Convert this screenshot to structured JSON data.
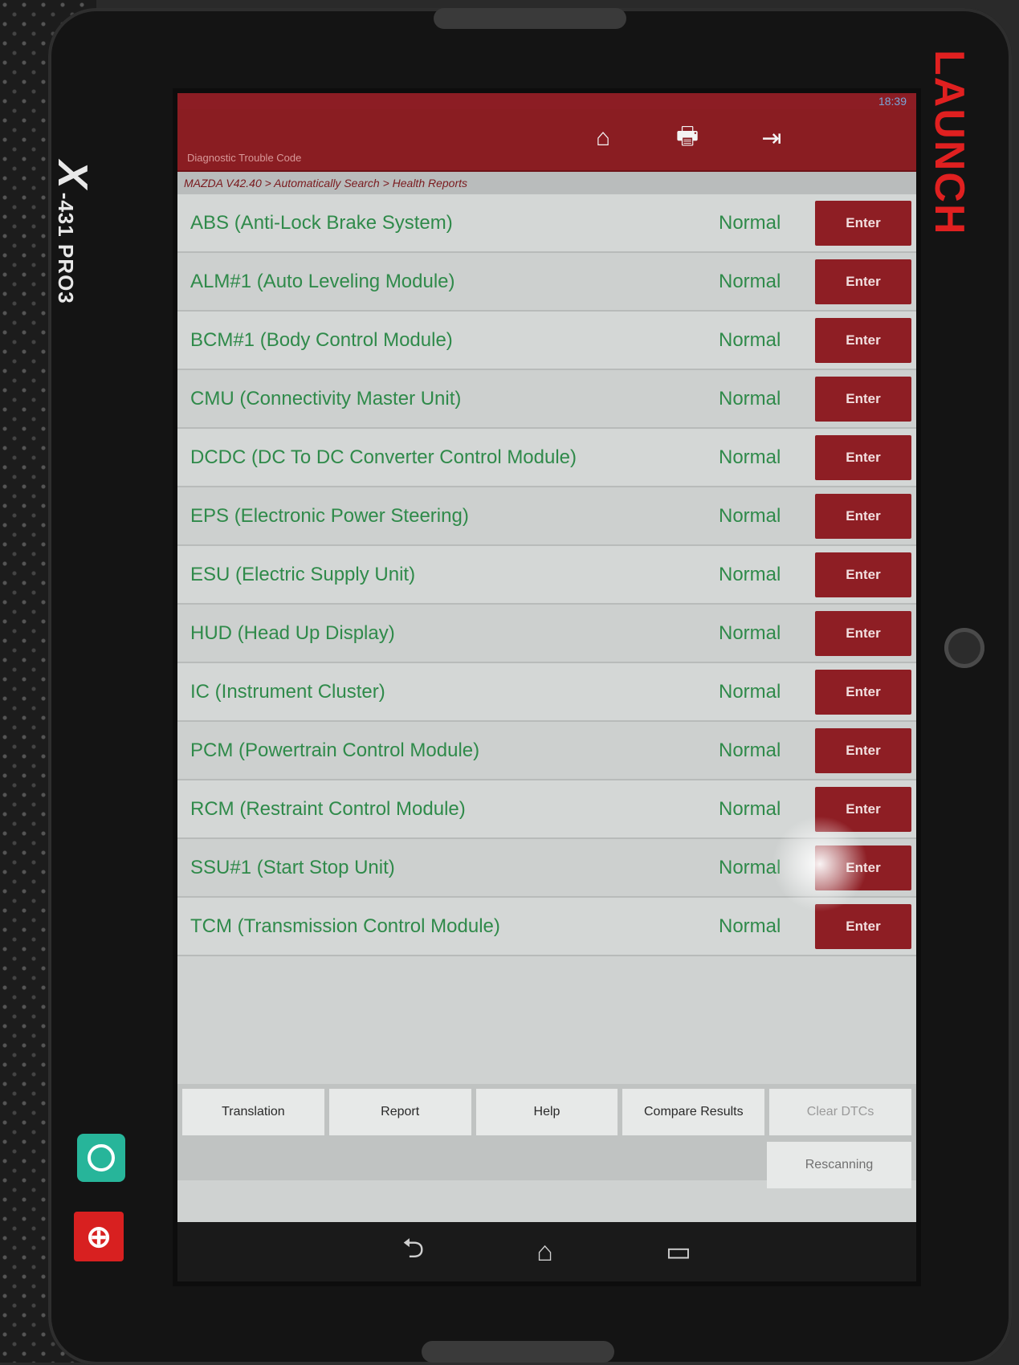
{
  "device": {
    "model_prefix": "X",
    "model": "-431 PRO3",
    "brand": "LAUNCH"
  },
  "status_bar": {
    "time": "18:39"
  },
  "header": {
    "title": "Diagnostic Trouble Code",
    "icons": [
      "home-icon",
      "print-icon",
      "exit-icon"
    ]
  },
  "breadcrumb": "MAZDA V42.40 > Automatically Search > Health Reports",
  "modules": [
    {
      "name": "ABS (Anti-Lock Brake System)",
      "status": "Normal",
      "action": "Enter"
    },
    {
      "name": "ALM#1 (Auto Leveling Module)",
      "status": "Normal",
      "action": "Enter"
    },
    {
      "name": "BCM#1 (Body Control Module)",
      "status": "Normal",
      "action": "Enter"
    },
    {
      "name": "CMU (Connectivity Master Unit)",
      "status": "Normal",
      "action": "Enter"
    },
    {
      "name": "DCDC (DC To DC Converter Control Module)",
      "status": "Normal",
      "action": "Enter"
    },
    {
      "name": "EPS (Electronic Power Steering)",
      "status": "Normal",
      "action": "Enter"
    },
    {
      "name": "ESU (Electric Supply Unit)",
      "status": "Normal",
      "action": "Enter"
    },
    {
      "name": "HUD (Head Up Display)",
      "status": "Normal",
      "action": "Enter"
    },
    {
      "name": "IC (Instrument Cluster)",
      "status": "Normal",
      "action": "Enter"
    },
    {
      "name": "PCM (Powertrain Control Module)",
      "status": "Normal",
      "action": "Enter"
    },
    {
      "name": "RCM (Restraint Control Module)",
      "status": "Normal",
      "action": "Enter"
    },
    {
      "name": "SSU#1 (Start Stop Unit)",
      "status": "Normal",
      "action": "Enter"
    },
    {
      "name": "TCM (Transmission Control Module)",
      "status": "Normal",
      "action": "Enter"
    }
  ],
  "toolbar": {
    "translation": "Translation",
    "report": "Report",
    "help": "Help",
    "compare": "Compare Results",
    "clear": "Clear DTCs",
    "rescan": "Rescanning"
  },
  "navbar": {
    "back": "⮌",
    "home": "⌂",
    "recent": "▭"
  },
  "colors": {
    "header_red": "#8a1d22",
    "enter_red": "#8e1e24",
    "status_green": "#2f8a4a",
    "brand_red": "#e02020"
  }
}
